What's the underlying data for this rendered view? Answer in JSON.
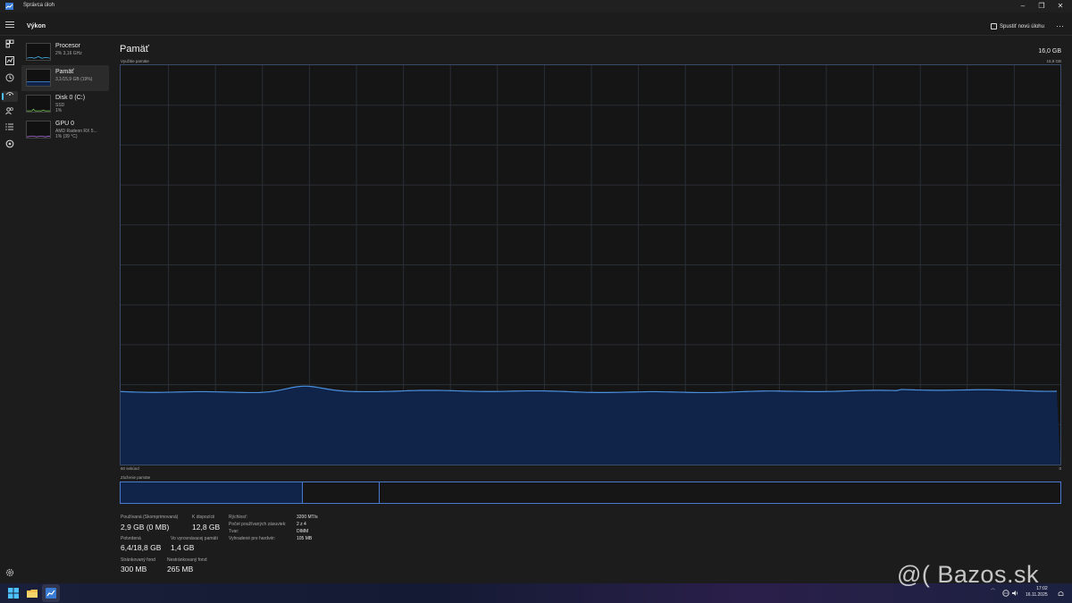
{
  "window": {
    "title": "Správca úloh"
  },
  "header": {
    "title": "Výkon",
    "new_task_label": "Spustiť novú úlohu",
    "more_label": "···"
  },
  "resources": [
    {
      "name": "Procesor",
      "sub": "2%  3,16 GHz",
      "sub2": ""
    },
    {
      "name": "Pamäť",
      "sub": "3,1/15,9 GB (19%)",
      "sub2": ""
    },
    {
      "name": "Disk 0 (C:)",
      "sub": "SSD",
      "sub2": "1%"
    },
    {
      "name": "GPU 0",
      "sub": "AMD Radeon RX 5...",
      "sub2": "1%  (39 °C)"
    }
  ],
  "main": {
    "title": "Pamäť",
    "total": "16,0 GB",
    "usage_label": "Využitie pamäte",
    "usage_max": "15,9 GB",
    "time_label": "60 sekúnd",
    "time_end": "0",
    "composition_label": "Zloženie pamäte",
    "usage_fraction": 0.185,
    "composition": {
      "used_fraction": 0.194,
      "modified_fraction": 0.082
    }
  },
  "stats": {
    "in_use_label": "Používaná (Skomprimovaná)",
    "in_use_value": "2,9 GB (0 MB)",
    "available_label": "K dispozícii",
    "available_value": "12,8 GB",
    "committed_label": "Potvrdená",
    "committed_value": "6,4/18,8 GB",
    "cached_label": "Vo vyrovnávacej pamäti",
    "cached_value": "1,4 GB",
    "paged_label": "Stránkovaný fond",
    "paged_value": "300 MB",
    "nonpaged_label": "Nestránkovaný fond",
    "nonpaged_value": "265 MB",
    "speed_label": "Rýchlosť:",
    "speed_value": "3200 MT/s",
    "slots_label": "Počet používaných zásuviek:",
    "slots_value": "2 z 4",
    "form_label": "Tvar:",
    "form_value": "DIMM",
    "reserved_label": "Vyhradené pre hardvér:",
    "reserved_value": "105 MB"
  },
  "taskbar": {
    "time": "17:02",
    "date": "16.11.2025"
  },
  "watermark": "@( Bazos.sk",
  "colors": {
    "accent": "#4cc2ff",
    "graph_line": "#4a8fe0",
    "graph_fill": "#0f2448",
    "border": "#3a4a6a"
  }
}
